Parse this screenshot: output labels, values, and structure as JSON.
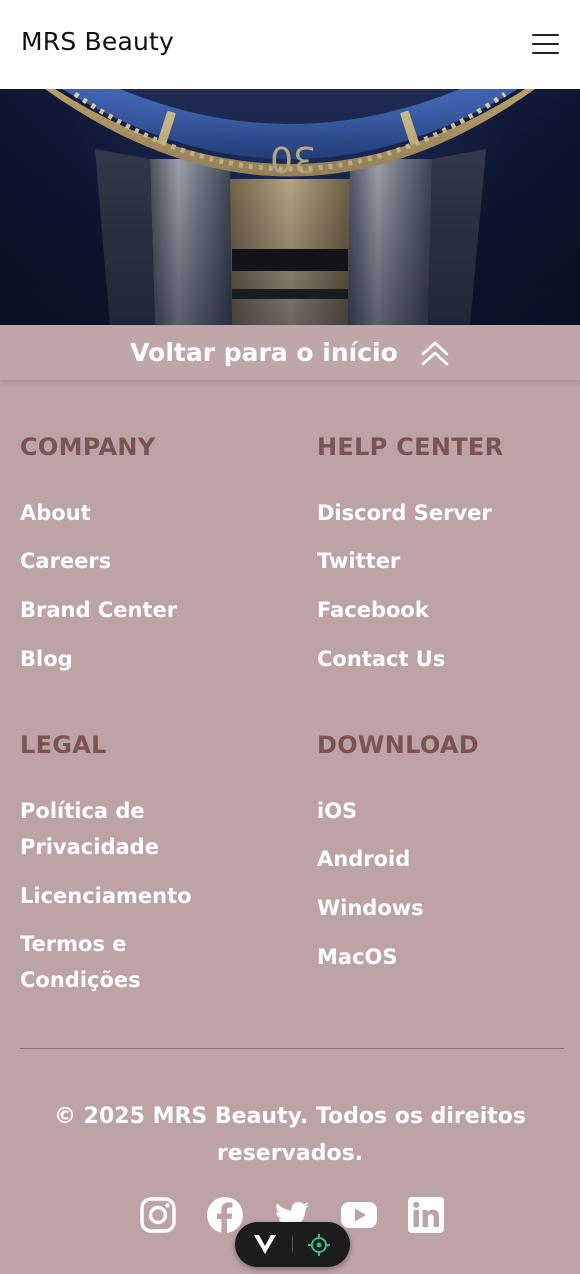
{
  "header": {
    "brand": "MRS Beauty",
    "menu_icon": "hamburger-menu-icon"
  },
  "hero": {
    "image": "luxury-watch-blue-bezel",
    "bezel_numeral": "30"
  },
  "back_to_top": {
    "label": "Voltar para o início",
    "icon": "double-chevron-up-icon"
  },
  "footer": {
    "company": {
      "heading": "COMPANY",
      "links": [
        "About",
        "Careers",
        "Brand Center",
        "Blog"
      ]
    },
    "help": {
      "heading": "HELP CENTER",
      "links": [
        "Discord Server",
        "Twitter",
        "Facebook",
        "Contact Us"
      ]
    },
    "legal": {
      "heading": "LEGAL",
      "links": [
        "Política de Privacidade",
        "Licenciamento",
        "Termos e Condições"
      ]
    },
    "download": {
      "heading": "DOWNLOAD",
      "links": [
        "iOS",
        "Android",
        "Windows",
        "MacOS"
      ]
    },
    "copyright": "© 2025 MRS Beauty. Todos os direitos reservados.",
    "social": [
      "instagram-icon",
      "facebook-icon",
      "twitter-icon",
      "youtube-icon",
      "linkedin-icon"
    ]
  },
  "toolbar_pill": {
    "icons": [
      "vue-logo-icon",
      "target-icon"
    ]
  },
  "colors": {
    "footer_bg": "#bda3a5",
    "heading": "#7a5352",
    "link": "#ffffff",
    "header_bg": "#ffffff"
  }
}
